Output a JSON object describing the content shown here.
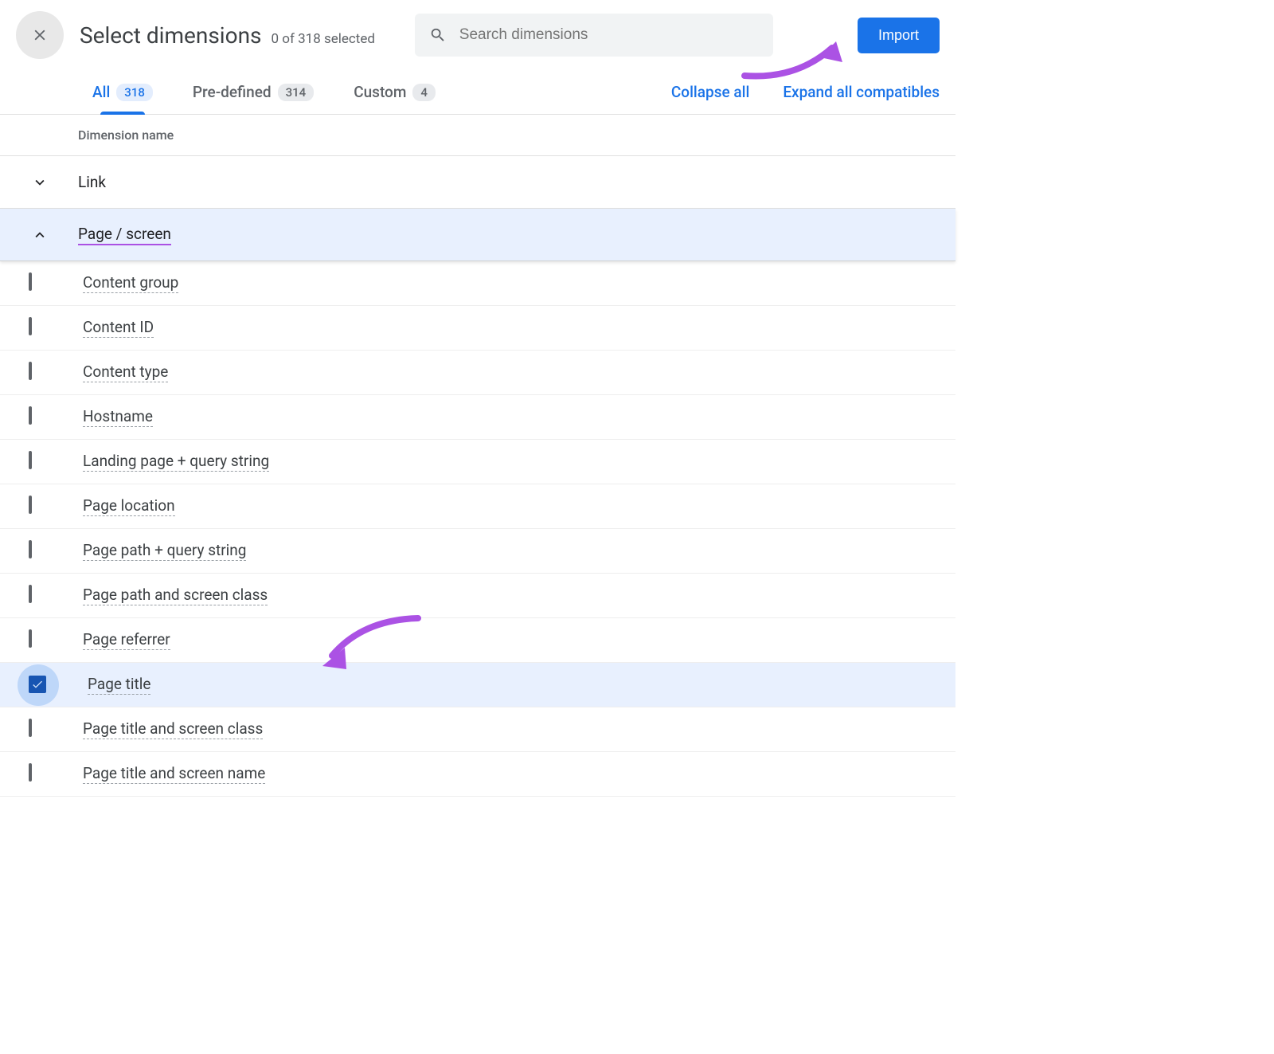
{
  "header": {
    "title": "Select dimensions",
    "subtitle": "0 of 318 selected",
    "search_placeholder": "Search dimensions",
    "import_label": "Import"
  },
  "tabs": [
    {
      "label": "All",
      "count": "318",
      "active": true
    },
    {
      "label": "Pre-defined",
      "count": "314",
      "active": false
    },
    {
      "label": "Custom",
      "count": "4",
      "active": false
    }
  ],
  "actions": {
    "collapse": "Collapse all",
    "expand": "Expand all compatibles"
  },
  "column_header": "Dimension name",
  "groups": [
    {
      "label": "Link",
      "expanded": false,
      "highlight": false
    },
    {
      "label": "Page / screen",
      "expanded": true,
      "highlight": true
    }
  ],
  "items": [
    {
      "label": "Content group",
      "checked": false
    },
    {
      "label": "Content ID",
      "checked": false
    },
    {
      "label": "Content type",
      "checked": false
    },
    {
      "label": "Hostname",
      "checked": false
    },
    {
      "label": "Landing page + query string",
      "checked": false
    },
    {
      "label": "Page location",
      "checked": false
    },
    {
      "label": "Page path + query string",
      "checked": false
    },
    {
      "label": "Page path and screen class",
      "checked": false
    },
    {
      "label": "Page referrer",
      "checked": false
    },
    {
      "label": "Page title",
      "checked": true
    },
    {
      "label": "Page title and screen class",
      "checked": false
    },
    {
      "label": "Page title and screen name",
      "checked": false
    }
  ]
}
